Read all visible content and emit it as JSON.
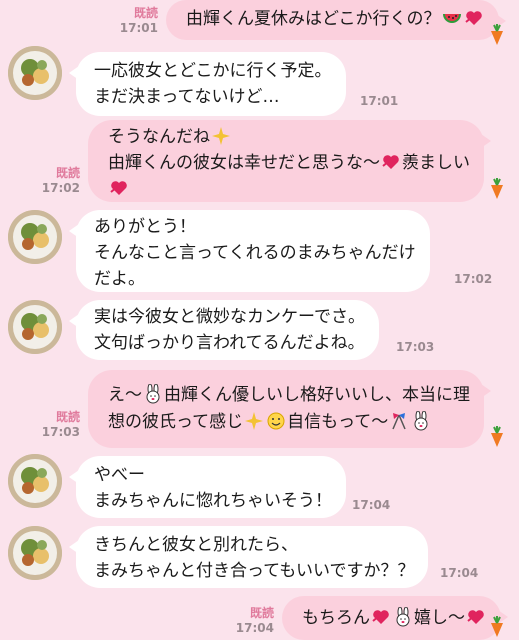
{
  "messages": [
    {
      "side": "out",
      "lines": [
        "由輝くん夏休みはどこか行くの？"
      ],
      "read": "既読",
      "time": "17:01"
    },
    {
      "side": "in",
      "lines": [
        "一応彼女とどこかに行く予定。",
        "まだ決まってないけど…"
      ],
      "time": "17:01"
    },
    {
      "side": "out",
      "lines": [
        "そうなんだね",
        "由輝くんの彼女は幸せだと思うな〜",
        "羨ましい"
      ],
      "read": "既読",
      "time": "17:02"
    },
    {
      "side": "in",
      "lines": [
        "ありがとう！",
        "そんなこと言ってくれるのまみちゃんだけ",
        "だよ。"
      ],
      "time": "17:02"
    },
    {
      "side": "in",
      "lines": [
        "実は今彼女と微妙なカンケーでさ。",
        "文句ばっかり言われてるんだよね。"
      ],
      "time": "17:03"
    },
    {
      "side": "out",
      "lines": [
        "え〜",
        "由輝くん優しいし格好いいし、本当に理",
        "想の彼氏って感じ",
        "自信もって〜"
      ],
      "read": "既読",
      "time": "17:03"
    },
    {
      "side": "in",
      "lines": [
        "やべー",
        "まみちゃんに惚れちゃいそう！"
      ],
      "time": "17:04"
    },
    {
      "side": "in",
      "lines": [
        "きちんと彼女と別れたら、",
        "まみちゃんと付き合ってもいいですか？？"
      ],
      "time": "17:04"
    },
    {
      "side": "out",
      "lines": [
        "もちろん",
        "嬉し〜"
      ],
      "read": "既読",
      "time": "17:04"
    }
  ],
  "icons": [
    "watermelon-icon",
    "heart-icon",
    "sparkle-icon",
    "bunny-icon",
    "smile-icon",
    "flags-icon",
    "carrot-icon",
    "avatar-food-photo"
  ],
  "colors": {
    "background": "#fbe3ec",
    "incoming_bubble": "#ffffff",
    "outgoing_bubble": "#fbd0dd",
    "read_label": "#e07a9c"
  }
}
